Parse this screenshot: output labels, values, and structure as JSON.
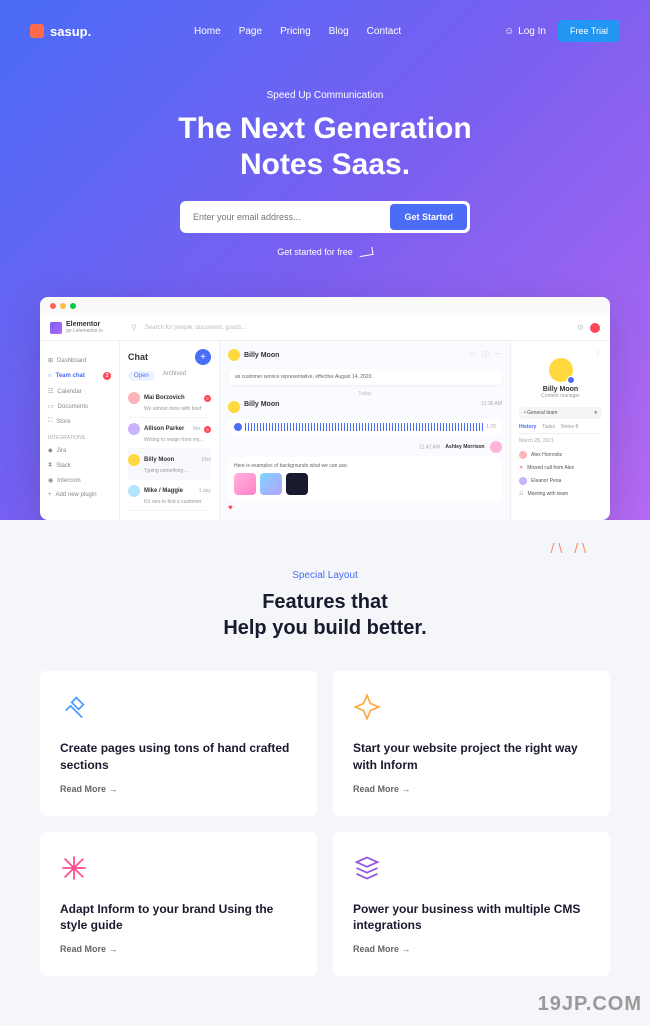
{
  "nav": {
    "logo": "sasup.",
    "links": [
      "Home",
      "Page",
      "Pricing",
      "Blog",
      "Contact"
    ],
    "login": "Log In",
    "trial": "Free Trial"
  },
  "hero": {
    "eyebrow": "Speed Up Communication",
    "title_l1": "The Next Generation",
    "title_l2": "Notes Saas.",
    "email_placeholder": "Enter your email address...",
    "cta": "Get Started",
    "free": "Get started for free"
  },
  "mockup": {
    "brand": "Elementor",
    "brand_sub": "go.t.elementor.io",
    "search_placeholder": "Search for people, document, goods...",
    "sidebar": {
      "items": [
        {
          "icon": "⊞",
          "label": "Dashboard"
        },
        {
          "icon": "○",
          "label": "Team chat",
          "badge": "3",
          "active": true
        },
        {
          "icon": "☷",
          "label": "Calendar"
        },
        {
          "icon": "▭",
          "label": "Documents"
        },
        {
          "icon": "⛶",
          "label": "Store"
        }
      ],
      "int_label": "INTEGRATIONS",
      "integrations": [
        {
          "icon": "◆",
          "label": "Jira"
        },
        {
          "icon": "⧗",
          "label": "Slack"
        },
        {
          "icon": "◉",
          "label": "Intercom"
        },
        {
          "icon": "+",
          "label": "Add new plugin"
        }
      ]
    },
    "chat": {
      "title": "Chat",
      "tabs": [
        "Open",
        "Archived"
      ],
      "items": [
        {
          "name": "Mai Borzovich",
          "msg": "We almost done with brief",
          "time": "",
          "badge": "2"
        },
        {
          "name": "Allison Parker",
          "msg": "Writing to resign from my...",
          "time": "8m",
          "badge": "5"
        },
        {
          "name": "Billy Moon",
          "msg": "Typing something ...",
          "time": "15m",
          "active": true
        },
        {
          "name": "Mike / Maggie",
          "msg": "It's rare to find a customer",
          "time": "1 day"
        }
      ]
    },
    "thread": {
      "name": "Billy Moon",
      "msg1": "as customer service representative, effective August 14, 2020.",
      "date": "Today",
      "time1": "11:36 AM",
      "time2": "11:42 AM",
      "sender2": "Ashley Morrison",
      "msg2": "Here is examples of backgrounds what we can use."
    },
    "profile": {
      "name": "Billy Moon",
      "role": "Content manager",
      "team": "• General team",
      "tabs": [
        "History",
        "Tasks",
        "Notes 8"
      ],
      "date": "March 28, 2021",
      "items": [
        {
          "label": "Alex Horrovitz"
        },
        {
          "label": "Missed call from Alex"
        },
        {
          "label": "Eleanor Pena"
        },
        {
          "label": "Meeting with team"
        }
      ]
    }
  },
  "features": {
    "eyebrow": "Special Layout",
    "title_l1": "Features that",
    "title_l2": "Help you build better.",
    "cards": [
      {
        "title": "Create pages using tons of hand crafted sections",
        "more": "Read More →"
      },
      {
        "title": "Start your website project the right way with Inform",
        "more": "Read More →"
      },
      {
        "title": "Adapt Inform to your brand Using the style guide",
        "more": "Read More →"
      },
      {
        "title": "Power your business with multiple CMS integrations",
        "more": "Read More →"
      }
    ]
  },
  "watermark": "19JP.COM"
}
